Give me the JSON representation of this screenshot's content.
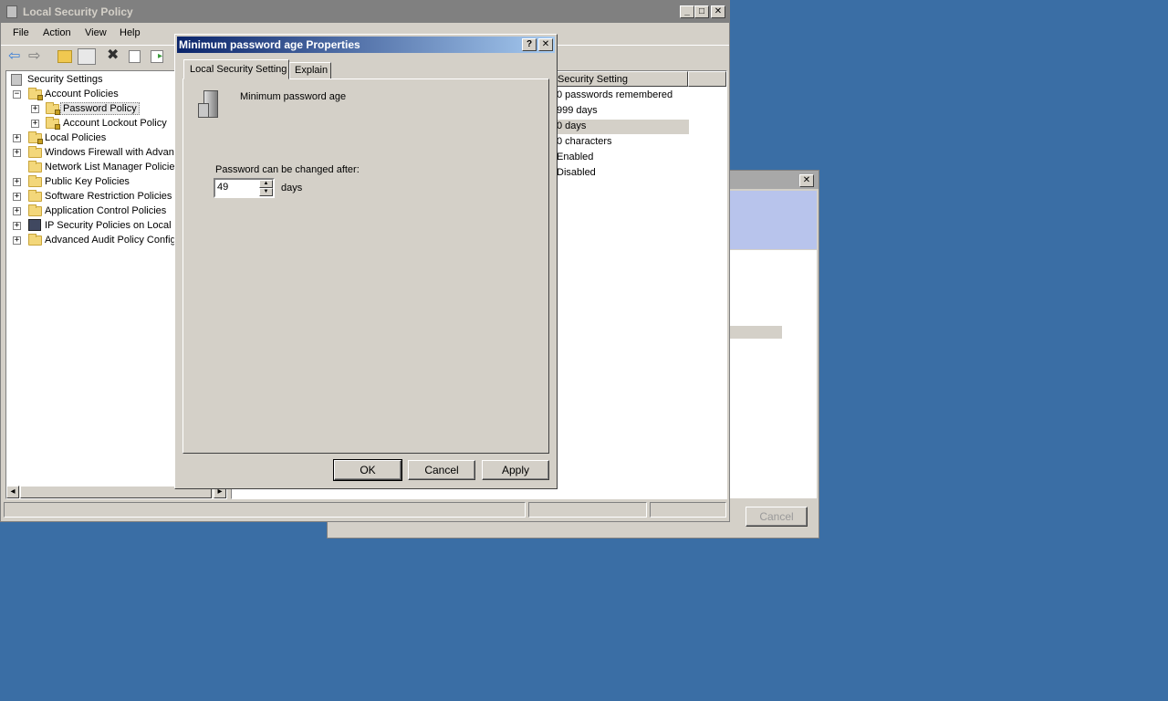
{
  "main_window": {
    "title": "Local Security Policy",
    "menu": [
      "File",
      "Action",
      "View",
      "Help"
    ]
  },
  "tree": {
    "root": "Security Settings",
    "items": [
      "Account Policies",
      "Password Policy",
      "Account Lockout Policy",
      "Local Policies",
      "Windows Firewall with Advanc",
      "Network List Manager Policies",
      "Public Key Policies",
      "Software Restriction Policies",
      "Application Control Policies",
      "IP Security Policies on Local C",
      "Advanced Audit Policy Configu"
    ]
  },
  "list": {
    "header": "Security Setting",
    "rows": [
      "0 passwords remembered",
      "999 days",
      "0 days",
      "0 characters",
      "Enabled",
      "Disabled"
    ]
  },
  "dialog": {
    "title": "Minimum password age Properties",
    "tabs": [
      "Local Security Setting",
      "Explain"
    ],
    "policy_name": "Minimum password age",
    "field_label": "Password can be changed after:",
    "field_value": "49",
    "unit": "days",
    "buttons": {
      "ok": "OK",
      "cancel": "Cancel",
      "apply": "Apply"
    }
  },
  "background_dialog": {
    "cancel": "Cancel"
  },
  "colors": {
    "desktop": "#3a6ea5",
    "titlebar_active_start": "#0a246a",
    "titlebar_active_end": "#a6caf0",
    "titlebar_inactive": "#808080"
  }
}
